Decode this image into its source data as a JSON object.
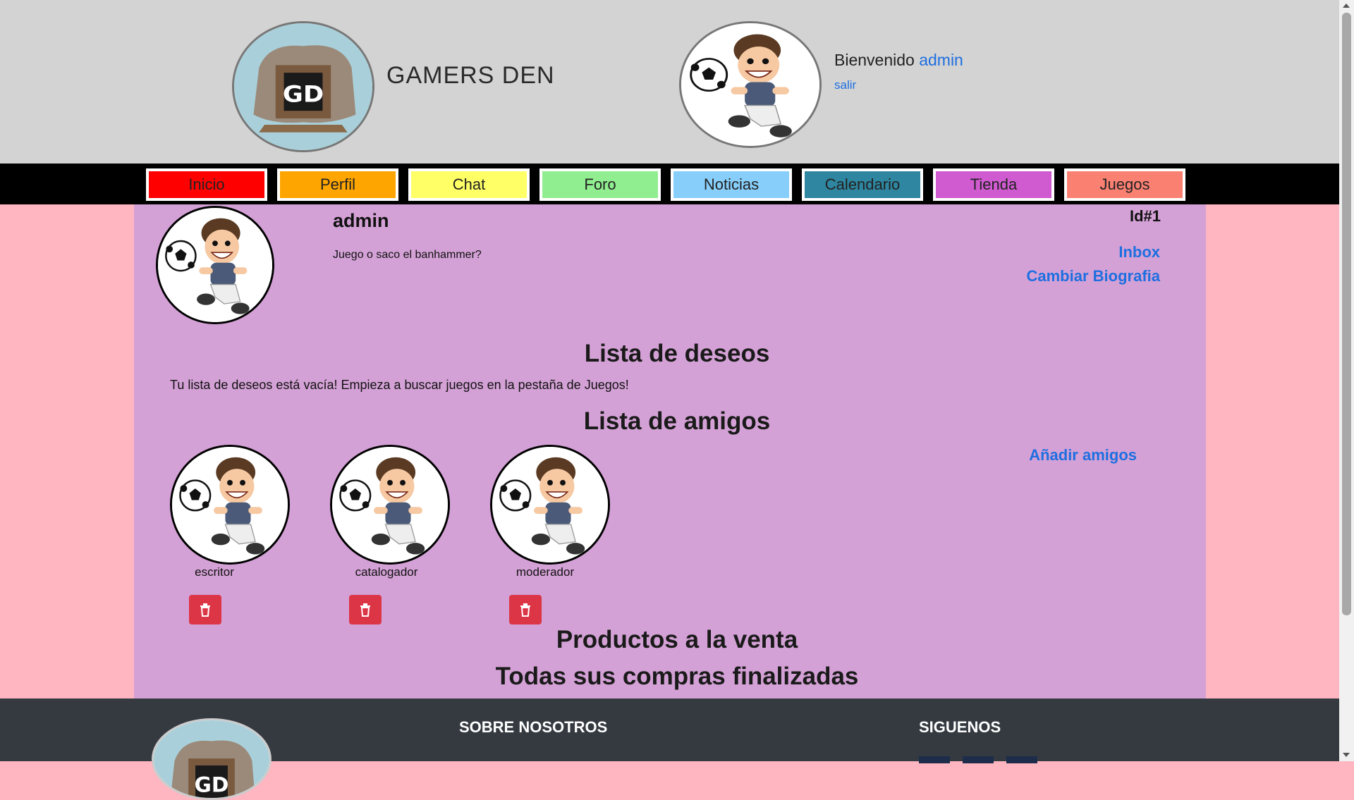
{
  "header": {
    "site_title": "GAMERS DEN",
    "welcome_text": "Bienvenido",
    "welcome_user": "admin",
    "logout_label": "salir",
    "logo_letters": "GD"
  },
  "nav": {
    "items": [
      {
        "label": "Inicio",
        "color": "#ff0000"
      },
      {
        "label": "Perfil",
        "color": "#ffa500"
      },
      {
        "label": "Chat",
        "color": "#ffff66"
      },
      {
        "label": "Foro",
        "color": "#90ee90"
      },
      {
        "label": "Noticias",
        "color": "#87cefa"
      },
      {
        "label": "Calendario",
        "color": "#2e86a0"
      },
      {
        "label": "Tienda",
        "color": "#d05ad0"
      },
      {
        "label": "Juegos",
        "color": "#fa8072"
      }
    ]
  },
  "profile": {
    "username": "admin",
    "id_label": "Id#1",
    "bio": "Juego o saco el banhammer?",
    "inbox_label": "Inbox",
    "change_bio_label": "Cambiar Biografia"
  },
  "wishlist": {
    "title": "Lista de deseos",
    "empty_message": "Tu lista de deseos está vacía! Empieza a buscar juegos en la pestaña de Juegos!"
  },
  "friends": {
    "title": "Lista de amigos",
    "add_label": "Añadir amigos",
    "items": [
      {
        "name": "escritor"
      },
      {
        "name": "catalogador"
      },
      {
        "name": "moderador"
      }
    ]
  },
  "products": {
    "for_sale_title": "Productos a la venta",
    "purchases_title": "Todas sus compras finalizadas"
  },
  "footer": {
    "about_title": "SOBRE NOSOTROS",
    "follow_title": "SIGUENOS"
  },
  "colors": {
    "page_bg": "#ffb6c1",
    "main_bg": "#d4a1d6",
    "header_bg": "#d3d3d3",
    "link": "#1e6fe0",
    "danger": "#dc3545",
    "footer_bg": "#343a40"
  }
}
